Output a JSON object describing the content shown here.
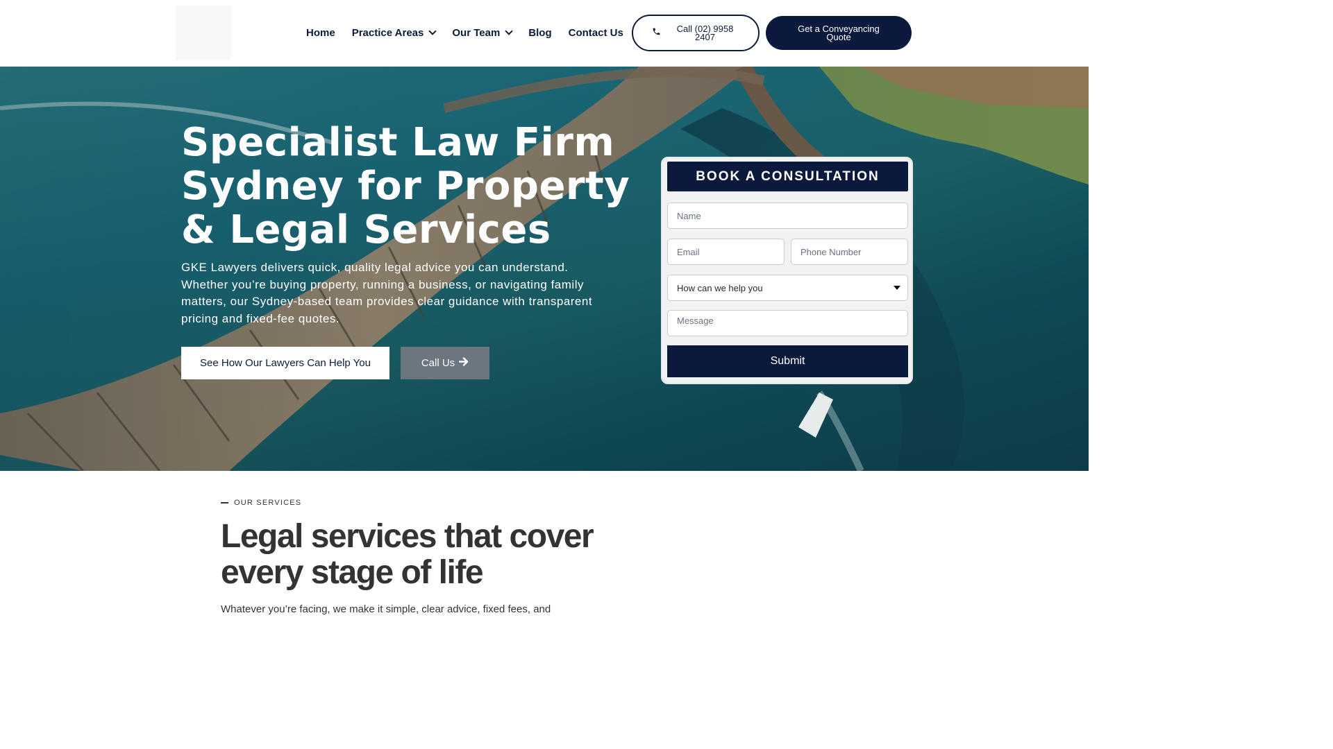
{
  "header": {
    "nav": [
      {
        "label": "Home"
      },
      {
        "label": "Practice Areas"
      },
      {
        "label": "Our Team"
      },
      {
        "label": "Blog"
      },
      {
        "label": "Contact Us"
      }
    ],
    "call_button": "Call (02) 9958 2407",
    "quote_button": "Get a Conveyancing Quote"
  },
  "hero": {
    "title_lines": [
      "Specialist Law Firm",
      "Sydney for Property",
      "& Legal Services"
    ],
    "text": "GKE Lawyers delivers quick, quality legal advice you can understand. Whether you’re buying property, running a business, or navigating family matters, our Sydney-based team provides clear guidance with transparent pricing and fixed-fee quotes.",
    "primary_button": "See How Our Lawyers Can Help You",
    "secondary_button": "Call Us"
  },
  "form": {
    "heading": "BOOK A CONSULTATION",
    "name_placeholder": "Name",
    "email_placeholder": "Email",
    "phone_placeholder": "Phone Number",
    "select_value": "How can we help you",
    "message_placeholder": "Message",
    "submit": "Submit"
  },
  "services": {
    "eyebrow": "OUR SERVICES",
    "title": "Legal services that cover every stage of life",
    "text": "Whatever you’re facing, we make it simple, clear advice, fixed fees, and"
  },
  "colors": {
    "navy": "#0b1a3c",
    "call_us_button": "#6b7680",
    "hero_water": "#1b6a7a"
  },
  "icons": {
    "phone": "phone-icon",
    "arrow": "arrow-right-icon",
    "chevron": "chevron-down-icon",
    "caret": "caret-down-icon"
  }
}
